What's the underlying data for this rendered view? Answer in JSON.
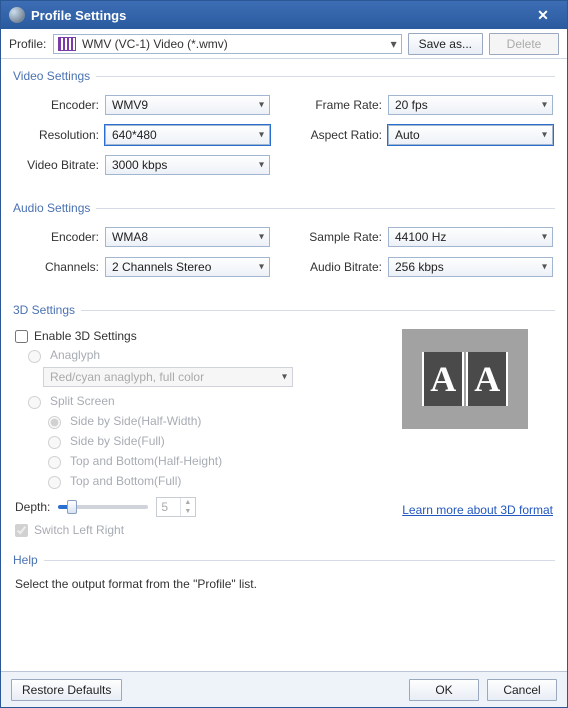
{
  "title": "Profile Settings",
  "profileRow": {
    "label": "Profile:",
    "selected": "WMV (VC-1) Video (*.wmv)",
    "saveAs": "Save as...",
    "delete": "Delete"
  },
  "videoSettings": {
    "legend": "Video Settings",
    "encoderLabel": "Encoder:",
    "encoder": "WMV9",
    "resolutionLabel": "Resolution:",
    "resolution": "640*480",
    "videoBitrateLabel": "Video Bitrate:",
    "videoBitrate": "3000 kbps",
    "frameRateLabel": "Frame Rate:",
    "frameRate": "20 fps",
    "aspectRatioLabel": "Aspect Ratio:",
    "aspectRatio": "Auto"
  },
  "audioSettings": {
    "legend": "Audio Settings",
    "encoderLabel": "Encoder:",
    "encoder": "WMA8",
    "channelsLabel": "Channels:",
    "channels": "2 Channels Stereo",
    "sampleRateLabel": "Sample Rate:",
    "sampleRate": "44100 Hz",
    "audioBitrateLabel": "Audio Bitrate:",
    "audioBitrate": "256 kbps"
  },
  "threeD": {
    "legend": "3D Settings",
    "enable": "Enable 3D Settings",
    "anaglyph": "Anaglyph",
    "anaglyphMode": "Red/cyan anaglyph, full color",
    "splitScreen": "Split Screen",
    "sideHalf": "Side by Side(Half-Width)",
    "sideFull": "Side by Side(Full)",
    "topHalf": "Top and Bottom(Half-Height)",
    "topFull": "Top and Bottom(Full)",
    "depthLabel": "Depth:",
    "depthValue": "5",
    "switchLR": "Switch Left Right",
    "learnMore": "Learn more about 3D format"
  },
  "help": {
    "legend": "Help",
    "text": "Select the output format from the \"Profile\" list."
  },
  "footer": {
    "restore": "Restore Defaults",
    "ok": "OK",
    "cancel": "Cancel"
  }
}
